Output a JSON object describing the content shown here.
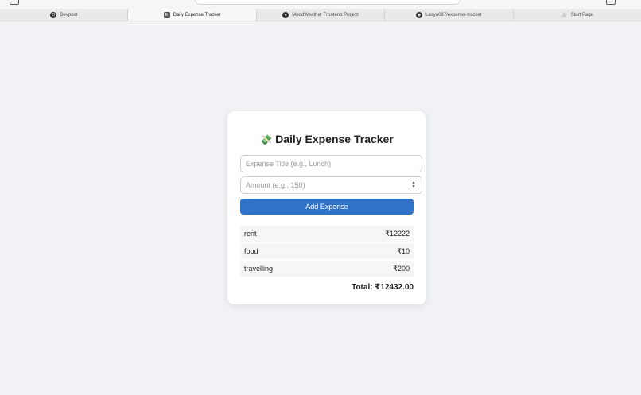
{
  "browser": {
    "tabs": [
      {
        "label": "Devpost",
        "icon": "devpost-icon",
        "active": false
      },
      {
        "label": "Daily Expense Tracker",
        "icon": "page-icon",
        "active": true
      },
      {
        "label": "MoodWeather Frontend Project",
        "icon": "globe-icon",
        "active": false
      },
      {
        "label": "Lasya087/expense-tracker",
        "icon": "github-icon",
        "active": false
      },
      {
        "label": "Start Page",
        "icon": "star-icon",
        "active": false
      }
    ]
  },
  "app": {
    "emoji": "💸",
    "title": "Daily Expense Tracker",
    "title_placeholder": "Expense Title (e.g., Lunch)",
    "amount_placeholder": "Amount (e.g., 150)",
    "add_label": "Add Expense",
    "expenses": [
      {
        "name": "rent",
        "amount": "₹12222"
      },
      {
        "name": "food",
        "amount": "₹10"
      },
      {
        "name": "travelling",
        "amount": "₹200"
      }
    ],
    "total": "Total: ₹12432.00"
  },
  "colors": {
    "background": "#f0f2f5",
    "button": "#2f73c9"
  }
}
